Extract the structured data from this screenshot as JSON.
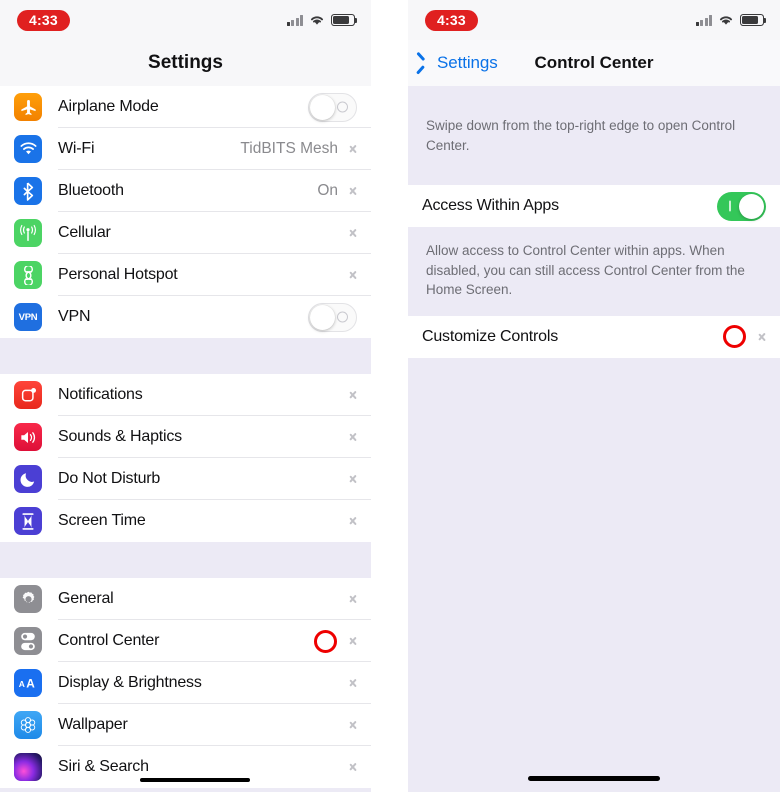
{
  "left_phone": {
    "status_bar": {
      "time": "4:33",
      "icons": [
        "cellular-signal-icon",
        "wifi-icon",
        "battery-icon"
      ]
    },
    "nav": {
      "title": "Settings"
    },
    "groups": [
      {
        "id": "connectivity",
        "rows": [
          {
            "label": "Airplane Mode",
            "icon": "airplane-icon",
            "accessory": "toggle",
            "toggle_state": "off",
            "value": ""
          },
          {
            "label": "Wi-Fi",
            "icon": "wifi-icon",
            "accessory": "chevron",
            "value": "TidBITS Mesh"
          },
          {
            "label": "Bluetooth",
            "icon": "bluetooth-icon",
            "accessory": "chevron",
            "value": "On"
          },
          {
            "label": "Cellular",
            "icon": "cellular-icon",
            "accessory": "chevron",
            "value": ""
          },
          {
            "label": "Personal Hotspot",
            "icon": "hotspot-icon",
            "accessory": "chevron",
            "value": ""
          },
          {
            "label": "VPN",
            "icon": "vpn-icon",
            "accessory": "toggle",
            "toggle_state": "off",
            "value": ""
          }
        ]
      },
      {
        "id": "alerts",
        "rows": [
          {
            "label": "Notifications",
            "icon": "notifications-icon",
            "accessory": "chevron",
            "value": ""
          },
          {
            "label": "Sounds & Haptics",
            "icon": "sounds-icon",
            "accessory": "chevron",
            "value": ""
          },
          {
            "label": "Do Not Disturb",
            "icon": "do-not-disturb-icon",
            "accessory": "chevron",
            "value": ""
          },
          {
            "label": "Screen Time",
            "icon": "screen-time-icon",
            "accessory": "chevron",
            "value": ""
          }
        ]
      },
      {
        "id": "system",
        "rows": [
          {
            "label": "General",
            "icon": "general-gear-icon",
            "accessory": "chevron",
            "value": ""
          },
          {
            "label": "Control Center",
            "icon": "control-center-icon",
            "accessory": "chevron",
            "value": "",
            "annotated": true
          },
          {
            "label": "Display & Brightness",
            "icon": "display-icon",
            "accessory": "chevron",
            "value": ""
          },
          {
            "label": "Wallpaper",
            "icon": "wallpaper-icon",
            "accessory": "chevron",
            "value": ""
          },
          {
            "label": "Siri & Search",
            "icon": "siri-icon",
            "accessory": "chevron",
            "value": "",
            "redacted": true
          }
        ]
      }
    ]
  },
  "right_phone": {
    "status_bar": {
      "time": "4:33",
      "icons": [
        "cellular-signal-icon",
        "wifi-icon",
        "battery-icon"
      ]
    },
    "nav": {
      "back_label": "Settings",
      "title": "Control Center"
    },
    "top_note": "Swipe down from the top-right edge to open Control Center.",
    "rows": [
      {
        "label": "Access Within Apps",
        "accessory": "toggle",
        "toggle_state": "on"
      }
    ],
    "footer_note": "Allow access to Control Center within apps. When disabled, you can still access Control Center from the Home Screen.",
    "rows2": [
      {
        "label": "Customize Controls",
        "accessory": "chevron",
        "annotated": true
      }
    ]
  },
  "colors": {
    "accent_blue": "#0a72e8",
    "toggle_on_green": "#34c759",
    "annotation_red": "#ee0000",
    "time_pill_red": "#e02020",
    "group_bg": "#eceaf5",
    "row_bg": "#ffffff",
    "separator": "#e6e6ea",
    "secondary_text": "#8a8a8e"
  }
}
